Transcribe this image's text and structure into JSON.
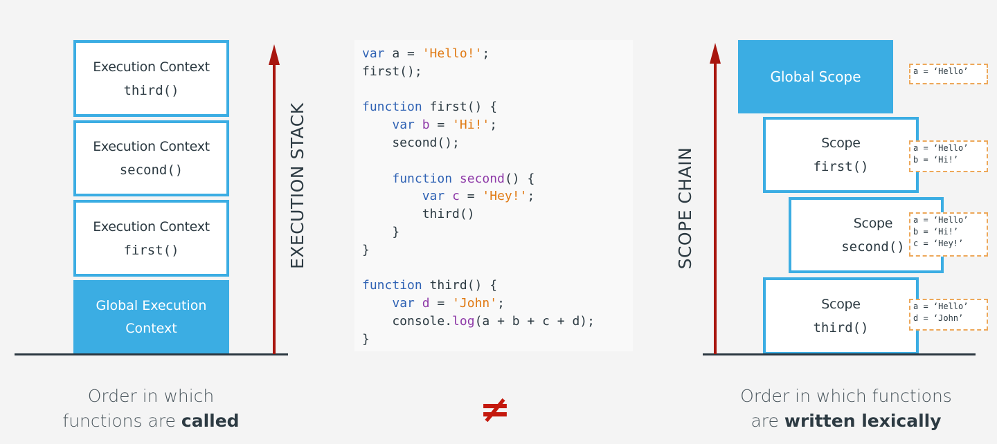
{
  "execution_stack": {
    "label": "EXECUTION STACK",
    "contexts": [
      {
        "title": "Execution Context",
        "function": "third()"
      },
      {
        "title": "Execution Context",
        "function": "second()"
      },
      {
        "title": "Execution Context",
        "function": "first()"
      }
    ],
    "global": {
      "line1": "Global Execution",
      "line2": "Context"
    },
    "caption": {
      "text": "Order in which",
      "text2": "functions are ",
      "bold": "called"
    }
  },
  "code": {
    "lines": [
      [
        {
          "t": "var",
          "c": "kw"
        },
        {
          "t": " a = "
        },
        {
          "t": "'Hello!'",
          "c": "str"
        },
        {
          "t": ";"
        }
      ],
      [
        {
          "t": "first();"
        }
      ],
      [],
      [
        {
          "t": "function",
          "c": "kw"
        },
        {
          "t": " first() {"
        }
      ],
      [
        {
          "t": "    "
        },
        {
          "t": "var",
          "c": "kw"
        },
        {
          "t": " "
        },
        {
          "t": "b",
          "c": "var"
        },
        {
          "t": " = "
        },
        {
          "t": "'Hi!'",
          "c": "str"
        },
        {
          "t": ";"
        }
      ],
      [
        {
          "t": "    second();"
        }
      ],
      [],
      [
        {
          "t": "    "
        },
        {
          "t": "function",
          "c": "kw"
        },
        {
          "t": " "
        },
        {
          "t": "second",
          "c": "var"
        },
        {
          "t": "() {"
        }
      ],
      [
        {
          "t": "        "
        },
        {
          "t": "var",
          "c": "kw"
        },
        {
          "t": " "
        },
        {
          "t": "c",
          "c": "var"
        },
        {
          "t": " = "
        },
        {
          "t": "'Hey!'",
          "c": "str"
        },
        {
          "t": ";"
        }
      ],
      [
        {
          "t": "        third()"
        }
      ],
      [
        {
          "t": "    }"
        }
      ],
      [
        {
          "t": "}"
        }
      ],
      [],
      [
        {
          "t": "function",
          "c": "kw"
        },
        {
          "t": " third() {"
        }
      ],
      [
        {
          "t": "    "
        },
        {
          "t": "var",
          "c": "kw"
        },
        {
          "t": " "
        },
        {
          "t": "d",
          "c": "var"
        },
        {
          "t": " = "
        },
        {
          "t": "'John'",
          "c": "str"
        },
        {
          "t": ";"
        }
      ],
      [
        {
          "t": "    console."
        },
        {
          "t": "log",
          "c": "var"
        },
        {
          "t": "(a + b + c + d);"
        }
      ],
      [
        {
          "t": "}"
        }
      ]
    ]
  },
  "not_equal_symbol": "≠",
  "scope_chain": {
    "label": "SCOPE CHAIN",
    "global": {
      "title": "Global Scope",
      "notes": "a = ‘Hello’"
    },
    "scopes": [
      {
        "title": "Scope",
        "function": "first()",
        "notes": "a = ‘Hello’\nb = ‘Hi!’"
      },
      {
        "title": "Scope",
        "function": "second()",
        "notes": "a = ‘Hello’\nb = ‘Hi!’\nc = ‘Hey!’"
      },
      {
        "title": "Scope",
        "function": "third()",
        "notes": "a = ‘Hello’\nd = ‘John’"
      }
    ],
    "caption": {
      "text": "Order in which functions",
      "text2": "are ",
      "bold": "written lexically"
    }
  },
  "colors": {
    "accent_blue": "#3badE3",
    "arrow_red": "#a8160f",
    "keyword": "#2f62b4",
    "string": "#e07a14",
    "identifier": "#8e3aa8",
    "notes_border": "#eda85a"
  }
}
